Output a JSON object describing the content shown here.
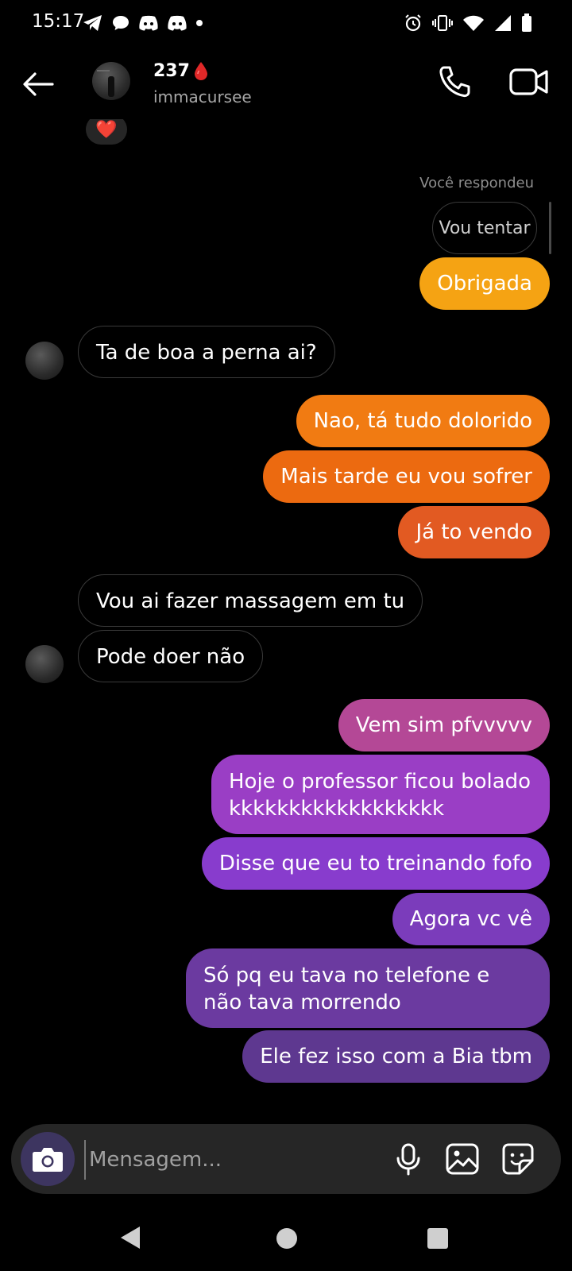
{
  "status_bar": {
    "time": "15:17"
  },
  "header": {
    "name": "237",
    "username": "immacursee",
    "name_icon": "blood-drop-icon"
  },
  "chat": {
    "reply_context": "Você respondeu",
    "reply_quote": "Vou tentar",
    "messages": [
      {
        "text": "Obrigada",
        "sender": "me"
      },
      {
        "text": "Ta de boa a perna ai?",
        "sender": "them"
      },
      {
        "text": "Nao, tá tudo dolorido",
        "sender": "me"
      },
      {
        "text": "Mais tarde eu vou sofrer",
        "sender": "me"
      },
      {
        "text": "Já to vendo",
        "sender": "me"
      },
      {
        "text": "Vou ai fazer massagem em tu",
        "sender": "them"
      },
      {
        "text": "Pode doer não",
        "sender": "them"
      },
      {
        "text": "Vem sim pfvvvvv",
        "sender": "me"
      },
      {
        "text": "Hoje o professor ficou bolado kkkkkkkkkkkkkkkkkk",
        "sender": "me"
      },
      {
        "text": "Disse que eu to treinando fofo",
        "sender": "me"
      },
      {
        "text": "Agora vc vê",
        "sender": "me"
      },
      {
        "text": "Só pq eu tava no telefone e não tava morrendo",
        "sender": "me"
      },
      {
        "text": "Ele fez isso com a Bia tbm",
        "sender": "me"
      }
    ],
    "reaction": "❤️"
  },
  "composer": {
    "placeholder": "Mensagem..."
  },
  "colors": {
    "background": "#000000",
    "sent_orange": "#f07a1a",
    "sent_purple": "#8a3fd0",
    "received_border": "#3a3a3a"
  }
}
